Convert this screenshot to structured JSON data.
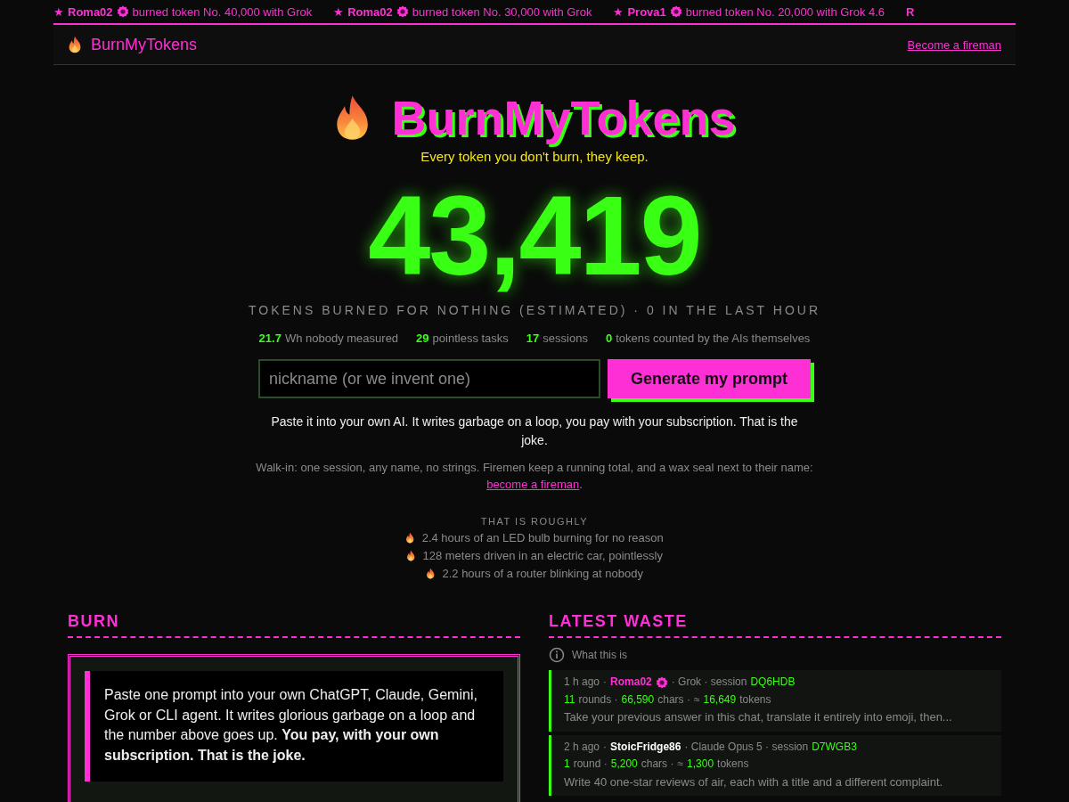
{
  "ticker": [
    {
      "star": "★",
      "name": "Roma02",
      "seal": true,
      "text": "burned token No. 40,000 with Grok"
    },
    {
      "star": "★",
      "name": "Roma02",
      "seal": true,
      "text": "burned token No. 30,000 with Grok"
    },
    {
      "star": "★",
      "name": "Prova1",
      "seal": true,
      "text": "burned token No. 20,000 with Grok 4.6"
    },
    {
      "name": "R",
      "seal": false
    }
  ],
  "header": {
    "brand": "BurnMyTokens",
    "link": "Become a fireman"
  },
  "hero": {
    "title": "BurnMyTokens",
    "tagline": "Every token you don't burn, they keep.",
    "count": "43,419",
    "caption": "TOKENS BURNED FOR NOTHING (ESTIMATED) · 0 IN THE LAST HOUR",
    "stats": [
      {
        "number": "21.7",
        "unit": "Wh nobody measured"
      },
      {
        "number": "29",
        "unit": "pointless tasks"
      },
      {
        "number": "17",
        "unit": "sessions"
      },
      {
        "number": "0",
        "unit": "tokens counted by the AIs themselves"
      }
    ],
    "nickname": {
      "placeholder": "nickname (or we invent one)"
    },
    "button": "Generate my prompt",
    "explain": "Paste it into your own AI. It writes garbage on a loop, you pay with your subscription. That is the joke.",
    "walkin": "Walk-in: one session, any name, no strings. Firemen keep a running total, and a wax seal next to their name: ",
    "walkin_link": "become a fireman",
    "walkin_end": ".",
    "roughly_title": "THAT IS ROUGHLY",
    "roughly": [
      "2.4 hours of an LED bulb burning for no reason",
      "128 meters driven in an electric car, pointlessly",
      "2.2 hours of a router blinking at nobody"
    ]
  },
  "burn": {
    "heading": "BURN",
    "prompt": "Paste one prompt into your own ChatGPT, Claude, Gemini, Grok or CLI agent. It writes glorious garbage on a loop and the number above goes up. **You pay, with your own subscription. That is the joke.**"
  },
  "latest": {
    "heading": "LATEST WASTE",
    "info": "What this is",
    "entries": [
      {
        "time": "1 h ago",
        "sep": "·",
        "user": "Roma02",
        "fireman": true,
        "model": "· Grok · session",
        "session": "DQ6HDB",
        "stats": [
          {
            "number": "11",
            "unit": "rounds ·"
          },
          {
            "number": "66,590",
            "unit": "chars ·"
          },
          {
            "prefix": "≈",
            "number": "16,649",
            "unit": "tokens"
          }
        ],
        "prompt": "Take your previous answer in this chat, translate it entirely into emoji, then..."
      },
      {
        "time": "2 h ago",
        "sep": "·",
        "user": "StoicFridge86",
        "fireman": false,
        "model": "· Claude Opus 5 · session",
        "session": "D7WGB3",
        "stats": [
          {
            "number": "1",
            "unit": "round ·"
          },
          {
            "number": "5,200",
            "unit": "chars ·"
          },
          {
            "prefix": "≈",
            "number": "1,300",
            "unit": "tokens"
          }
        ],
        "prompt": "Write 40 one-star reviews of air, each with a title and a different complaint."
      }
    ]
  }
}
